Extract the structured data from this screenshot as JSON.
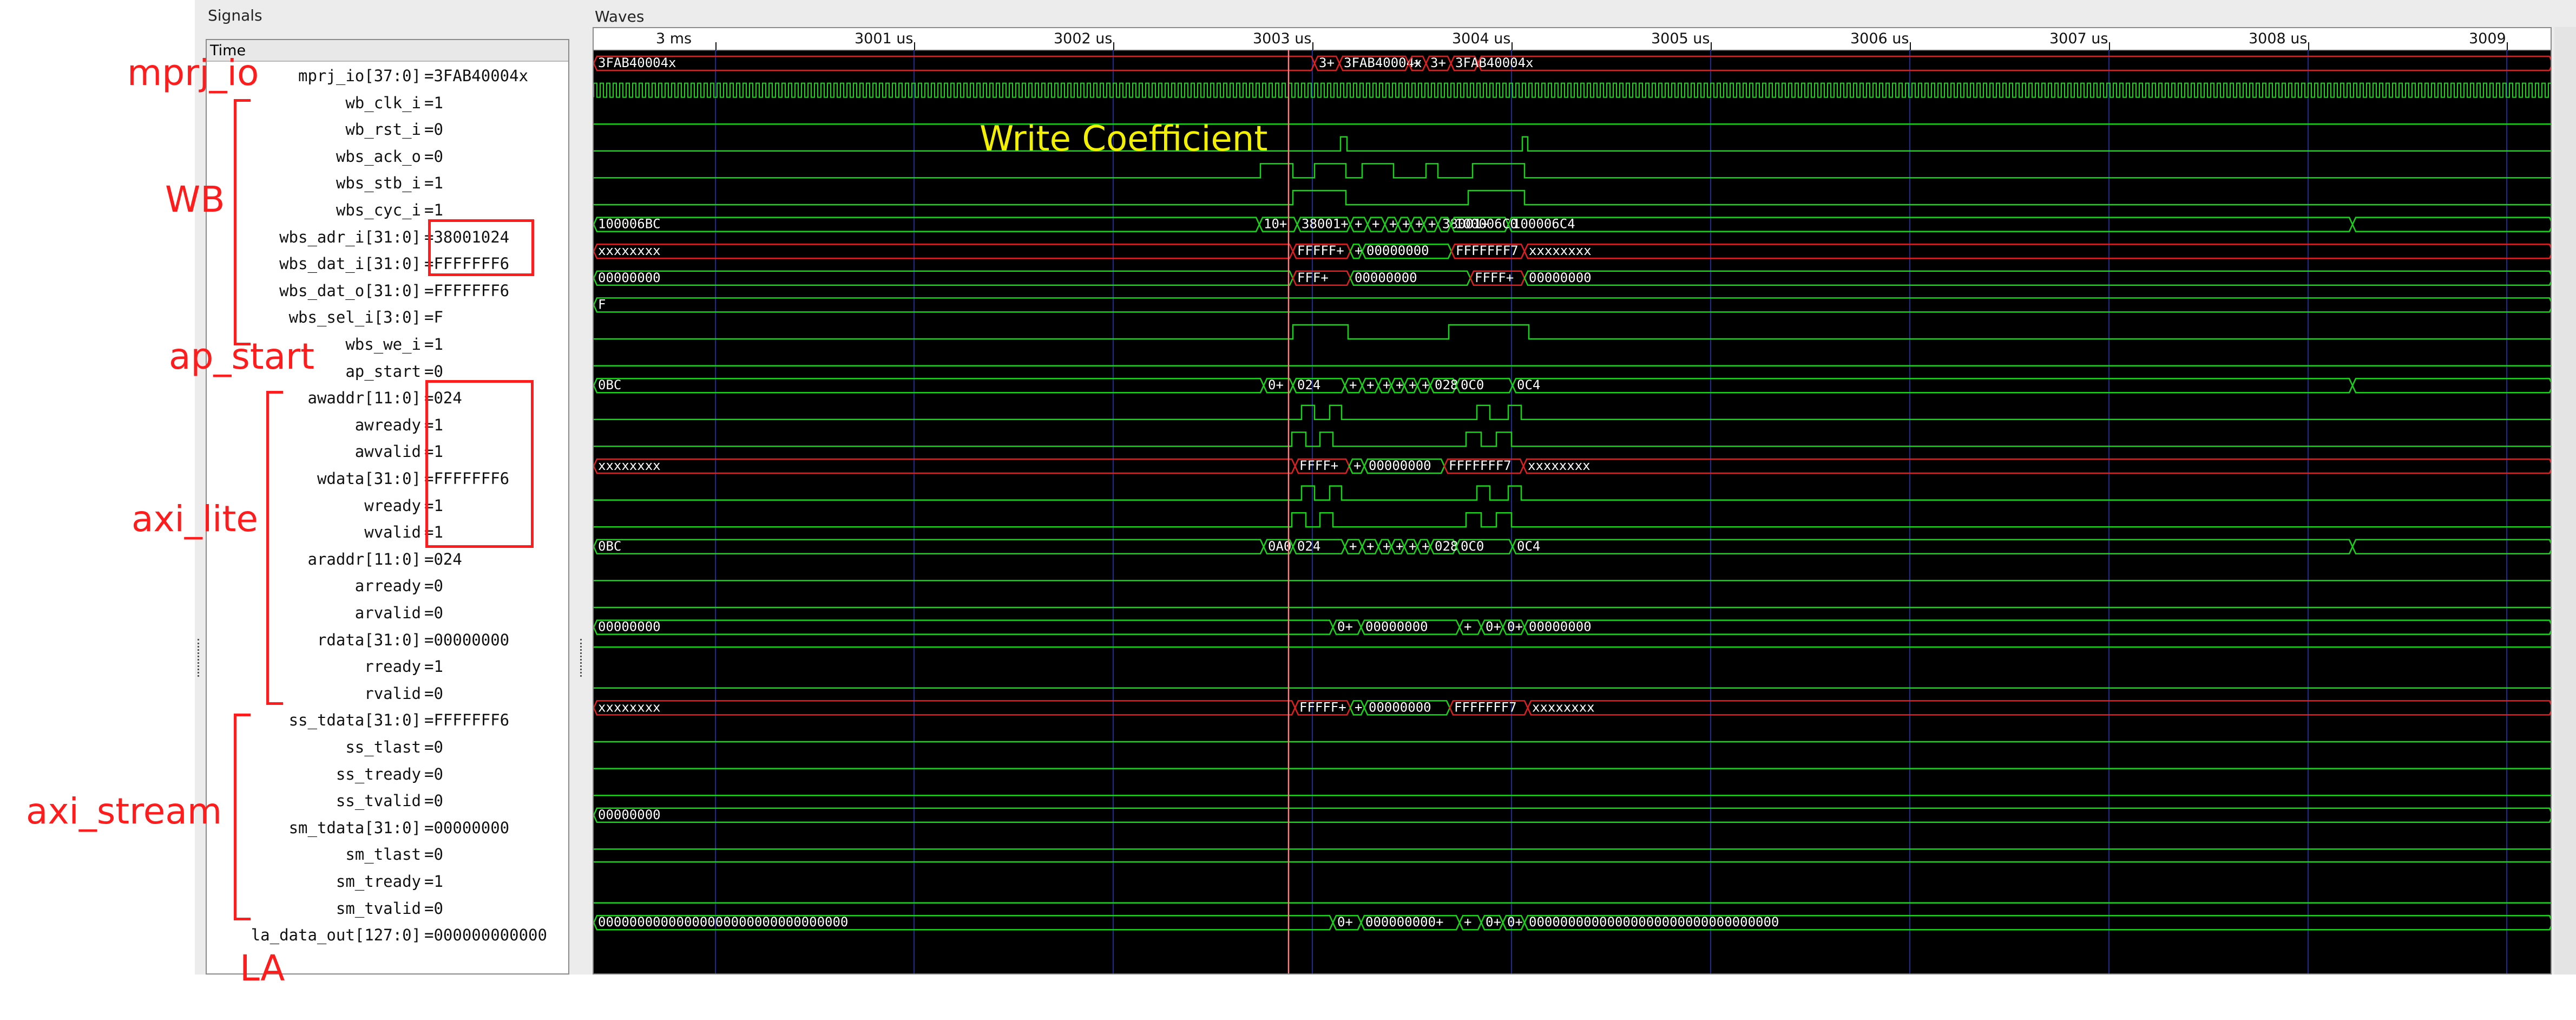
{
  "signals_pane": {
    "title": "Signals",
    "header": "Time"
  },
  "waves_pane": {
    "title": "Waves"
  },
  "timeline": {
    "ticks": [
      "3 ms",
      "3001 us",
      "3002 us",
      "3003 us",
      "3004 us",
      "3005 us",
      "3006 us",
      "3007 us",
      "3008 us",
      "3009"
    ]
  },
  "signals": [
    {
      "name": "mprj_io[37:0]",
      "value": "=3FAB40004x",
      "kind": "bus"
    },
    {
      "name": "wb_clk_i",
      "value": "=1",
      "kind": "clock"
    },
    {
      "name": "wb_rst_i",
      "value": "=0",
      "kind": "bit"
    },
    {
      "name": "wbs_ack_o",
      "value": "=0",
      "kind": "bit"
    },
    {
      "name": "wbs_stb_i",
      "value": "=1",
      "kind": "bit"
    },
    {
      "name": "wbs_cyc_i",
      "value": "=1",
      "kind": "bit"
    },
    {
      "name": "wbs_adr_i[31:0]",
      "value": "=38001024",
      "kind": "bus"
    },
    {
      "name": "wbs_dat_i[31:0]",
      "value": "=FFFFFFF6",
      "kind": "bus"
    },
    {
      "name": "wbs_dat_o[31:0]",
      "value": "=FFFFFFF6",
      "kind": "bus"
    },
    {
      "name": "wbs_sel_i[3:0]",
      "value": "=F",
      "kind": "bus"
    },
    {
      "name": "wbs_we_i",
      "value": "=1",
      "kind": "bit"
    },
    {
      "name": "ap_start",
      "value": "=0",
      "kind": "bit"
    },
    {
      "name": "awaddr[11:0]",
      "value": "=024",
      "kind": "bus"
    },
    {
      "name": "awready",
      "value": "=1",
      "kind": "bit"
    },
    {
      "name": "awvalid",
      "value": "=1",
      "kind": "bit"
    },
    {
      "name": "wdata[31:0]",
      "value": "=FFFFFFF6",
      "kind": "bus"
    },
    {
      "name": "wready",
      "value": "=1",
      "kind": "bit"
    },
    {
      "name": "wvalid",
      "value": "=1",
      "kind": "bit"
    },
    {
      "name": "araddr[11:0]",
      "value": "=024",
      "kind": "bus"
    },
    {
      "name": "arready",
      "value": "=0",
      "kind": "bit"
    },
    {
      "name": "arvalid",
      "value": "=0",
      "kind": "bit"
    },
    {
      "name": "rdata[31:0]",
      "value": "=00000000",
      "kind": "bus"
    },
    {
      "name": "rready",
      "value": "=1",
      "kind": "bit"
    },
    {
      "name": "rvalid",
      "value": "=0",
      "kind": "bit"
    },
    {
      "name": "ss_tdata[31:0]",
      "value": "=FFFFFFF6",
      "kind": "bus"
    },
    {
      "name": "ss_tlast",
      "value": "=0",
      "kind": "bit"
    },
    {
      "name": "ss_tready",
      "value": "=0",
      "kind": "bit"
    },
    {
      "name": "ss_tvalid",
      "value": "=0",
      "kind": "bit"
    },
    {
      "name": "sm_tdata[31:0]",
      "value": "=00000000",
      "kind": "bus"
    },
    {
      "name": "sm_tlast",
      "value": "=0",
      "kind": "bit"
    },
    {
      "name": "sm_tready",
      "value": "=1",
      "kind": "bit"
    },
    {
      "name": "sm_tvalid",
      "value": "=0",
      "kind": "bit"
    },
    {
      "name": "la_data_out[127:0]",
      "value": "=000000000000",
      "kind": "bus"
    }
  ],
  "wave_labels": [
    [
      "3FAB40004x",
      "3+",
      "3FAB40004x",
      "+",
      "3+",
      "3FAB40004x"
    ],
    [],
    [],
    [],
    [],
    [],
    [
      "100006BC",
      "10+",
      "38001+",
      "+",
      "+",
      "+",
      "+",
      "+",
      "+",
      "38001+",
      "100006C0",
      "100006C4"
    ],
    [
      "xxxxxxxx",
      "FFFFF+",
      "+",
      "00000000",
      "FFFFFFF7",
      "xxxxxxxx"
    ],
    [
      "00000000",
      "FFF+",
      "00000000",
      "FFFF+",
      "00000000"
    ],
    [
      "F"
    ],
    [],
    [],
    [
      "0BC",
      "0+",
      "024",
      "+",
      "+",
      "+",
      "+",
      "+",
      "+",
      "028",
      "0C0",
      "0C4"
    ],
    [],
    [],
    [
      "xxxxxxxx",
      "FFFF+",
      "+",
      "00000000",
      "FFFFFFF7",
      "xxxxxxxx"
    ],
    [],
    [],
    [
      "0BC",
      "0A0",
      "024",
      "+",
      "+",
      "+",
      "+",
      "+",
      "+",
      "028",
      "0C0",
      "0C4"
    ],
    [],
    [],
    [
      "00000000",
      "0+",
      "00000000",
      "+",
      "0+",
      "0+",
      "00000000"
    ],
    [],
    [],
    [
      "xxxxxxxx",
      "FFFFF+",
      "+",
      "00000000",
      "FFFFFFF7",
      "xxxxxxxx"
    ],
    [],
    [],
    [],
    [
      "00000000"
    ],
    [],
    [],
    [],
    [
      "00000000000000000000000000000000",
      "0+",
      "000000000+",
      "+",
      "0+",
      "0+",
      "00000000000000000000000000000000"
    ]
  ],
  "annotations": {
    "mprj_io": "mprj_io",
    "wb": "WB",
    "ap_start": "ap_start",
    "axi_lite": "axi_lite",
    "axi_stream": "axi_stream",
    "la": "LA",
    "write_coefficient": "Write Coefficient"
  },
  "colors": {
    "wave_green": "#19d419",
    "wave_red": "#e02020",
    "grid_blue": "#1a2d8f",
    "cursor": "#ff8080",
    "annotation": "#ff1c1c",
    "highlight_text": "#f2f000"
  }
}
